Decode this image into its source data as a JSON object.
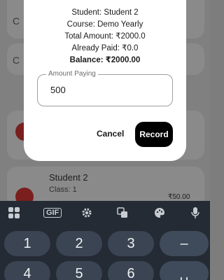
{
  "background": {
    "card_letter_1": "C",
    "card_letter_2": "C",
    "student_name": "Student 2",
    "student_class": "Class: 1",
    "student_amount": "₹50.00"
  },
  "dialog": {
    "student": "Student: Student 2",
    "course": "Course: Demo Yearly",
    "total_amount": "Total Amount: ₹2000.0",
    "already_paid": "Already Paid: ₹0.0",
    "balance": "Balance: ₹2000.00",
    "amount_field": {
      "label": "Amount Paying",
      "value": "500"
    },
    "cancel_label": "Cancel",
    "record_label": "Record"
  },
  "keyboard": {
    "toolbar": {
      "gif_label": "GIF",
      "icons": [
        "apps-grid-icon",
        "gif-icon",
        "gear-icon",
        "translate-icon",
        "palette-icon",
        "mic-icon"
      ]
    },
    "row1": [
      "1",
      "2",
      "3",
      "–"
    ],
    "row2": [
      "4",
      "5",
      "6",
      "␣"
    ]
  },
  "colors": {
    "overlay": "#808080",
    "dialog_bg": "#ffffff",
    "record_button": "#000000",
    "keyboard_bg": "#242b35",
    "key_bg": "#3a4452",
    "avatar_red": "#7a1e1e"
  }
}
